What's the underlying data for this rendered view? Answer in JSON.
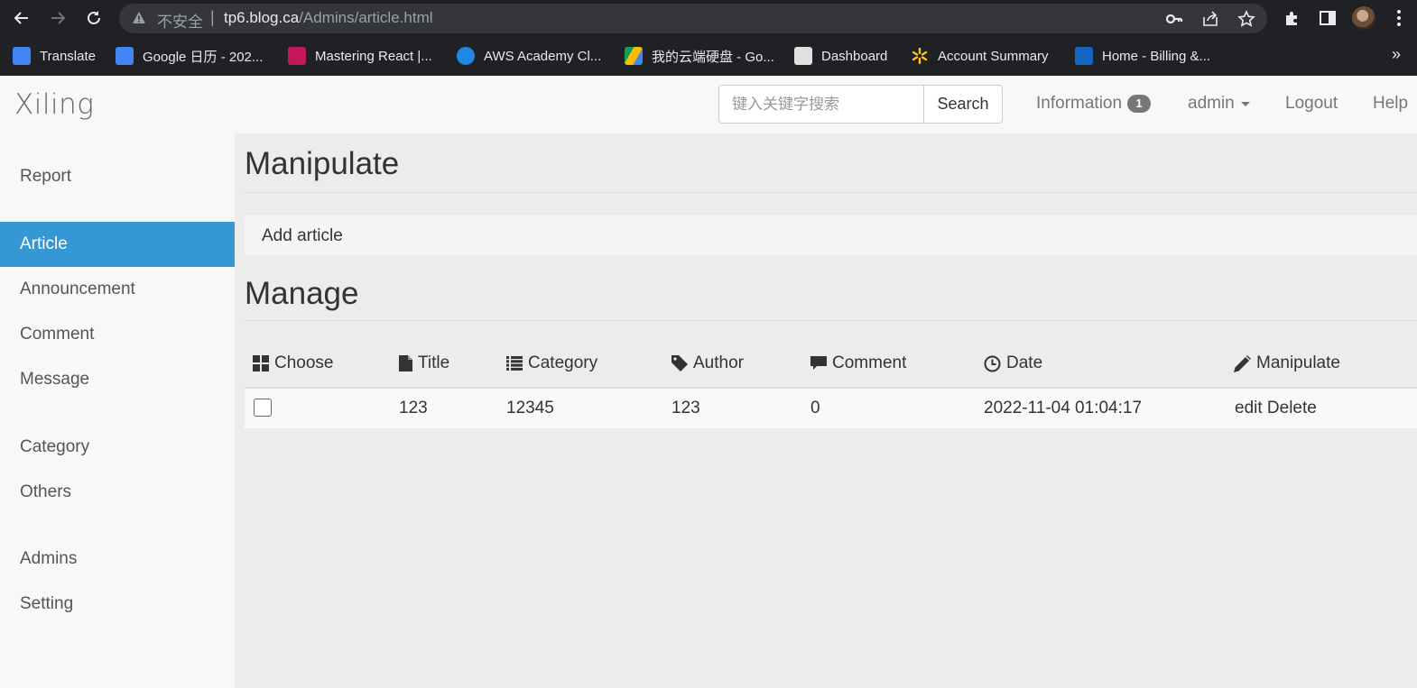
{
  "browser": {
    "insecure_label": "不安全",
    "url_host": "tp6.blog.ca",
    "url_path": "/Admins/article.html",
    "bookmarks": [
      {
        "label": "Translate",
        "color": "#4285f4"
      },
      {
        "label": "Google 日历 - 202...",
        "color": "#4285f4"
      },
      {
        "label": "Mastering React |...",
        "color": "#c2185b"
      },
      {
        "label": "AWS Academy Cl...",
        "color": "#1e88e5"
      },
      {
        "label": "我的云端硬盘 - Go...",
        "color": "#fbbc04"
      },
      {
        "label": "Dashboard",
        "color": "#e0e0e0"
      },
      {
        "label": "Account Summary",
        "color": "#ffc220"
      },
      {
        "label": "Home - Billing &...",
        "color": "#1565c0"
      }
    ],
    "more": "»"
  },
  "header": {
    "brand": "Xiling",
    "search_placeholder": "键入关键字搜索",
    "search_button": "Search",
    "information": "Information",
    "information_count": "1",
    "user": "admin",
    "logout": "Logout",
    "help": "Help"
  },
  "sidebar": {
    "items": [
      {
        "label": "Report",
        "active": false
      },
      {
        "label": "Article",
        "active": true
      },
      {
        "label": "Announcement",
        "active": false
      },
      {
        "label": "Comment",
        "active": false
      },
      {
        "label": "Message",
        "active": false
      },
      {
        "label": "Category",
        "active": false
      },
      {
        "label": "Others",
        "active": false
      },
      {
        "label": "Admins",
        "active": false
      },
      {
        "label": "Setting",
        "active": false
      }
    ]
  },
  "main": {
    "manipulate_heading": "Manipulate",
    "add_article": "Add article",
    "manage_heading": "Manage",
    "columns": [
      "Choose",
      "Title",
      "Category",
      "Author",
      "Comment",
      "Date",
      "Manipulate"
    ],
    "rows": [
      {
        "title": "123",
        "category": "12345",
        "author": "123",
        "comment": "0",
        "date": "2022-11-04 01:04:17",
        "edit": "edit",
        "delete": "Delete"
      }
    ]
  },
  "colors": {
    "accent": "#3398d3",
    "chrome": "#202124"
  }
}
